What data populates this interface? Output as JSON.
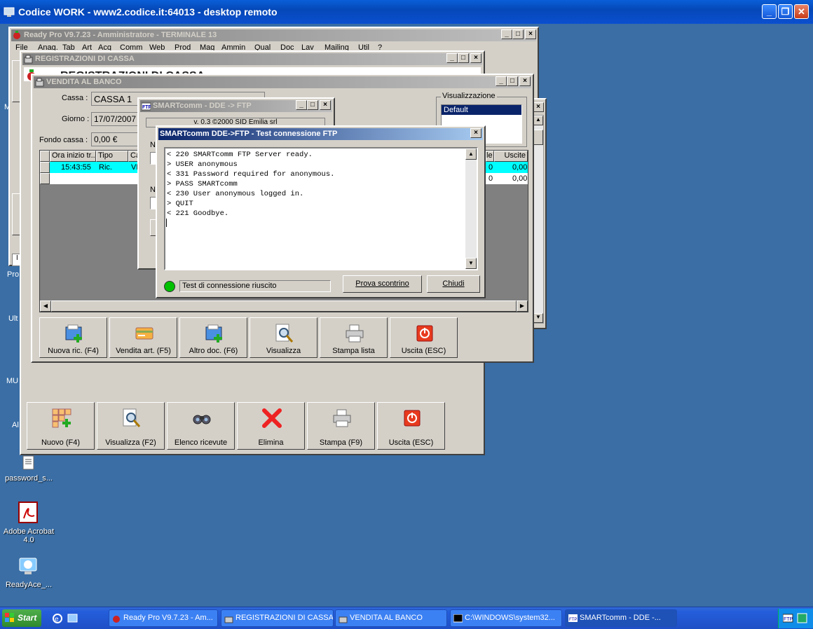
{
  "remote_desktop": {
    "title": "Codice WORK - www2.codice.it:64013 - desktop remoto"
  },
  "desktop_icons": [
    {
      "label": "password_s...",
      "icon": "text-file-icon"
    },
    {
      "label": "Adobe Acrobat 4.0",
      "icon": "acrobat-icon"
    },
    {
      "label": "ReadyAce_...",
      "icon": "readyace-icon"
    }
  ],
  "desktop_partial_labels": [
    "M",
    "Pro",
    "Ult",
    "MU",
    "Al"
  ],
  "readypro": {
    "title": "Ready Pro V9.7.23 - Amministratore - TERMINALE 13",
    "menu": [
      "File",
      "Anag.",
      "Tab",
      "Art",
      "Acq",
      "Comm",
      "Web",
      "Prod",
      "Mag",
      "Ammin",
      "Qual",
      "Doc",
      "Lav",
      "Mailing",
      "Util",
      "?"
    ]
  },
  "registrazioni": {
    "title": "REGISTRAZIONI DI CASSA",
    "header_text": "REGISTRAZIONI DI CASSA",
    "toolbar": [
      {
        "label": "Nuovo (F4)",
        "icon": "new-grid-icon"
      },
      {
        "label": "Visualizza (F2)",
        "icon": "magnifier-icon"
      },
      {
        "label": "Elenco ricevute",
        "icon": "binoculars-icon"
      },
      {
        "label": "Elimina",
        "icon": "delete-x-icon"
      },
      {
        "label": "Stampa (F9)",
        "icon": "printer-icon"
      },
      {
        "label": "Uscita (ESC)",
        "icon": "power-icon"
      }
    ]
  },
  "vendita": {
    "title": "VENDITA AL BANCO",
    "cassa_label": "Cassa :",
    "cassa_value": "CASSA 1",
    "giorno_label": "Giorno :",
    "giorno_value": "17/07/2007",
    "fondo_label": "Fondo cassa :",
    "fondo_value": "0,00 €",
    "visualizzazione_label": "Visualizzazione",
    "visualizzazione_items": [
      "Default"
    ],
    "grid_headers": [
      "Ora inizio tr...",
      "Tipo",
      "Ca"
    ],
    "grid_row": {
      "ora": "15:43:55",
      "tipo": "Ric.",
      "ca": "VE"
    },
    "grid_right_headers": [
      "le",
      "Uscite"
    ],
    "grid_right_row1": [
      "0",
      "0,00"
    ],
    "grid_right_row2": [
      "0",
      "0,00"
    ],
    "toolbar": [
      {
        "label": "Nuova ric. (F4)",
        "icon": "folder-add-icon"
      },
      {
        "label": "Vendita art. (F5)",
        "icon": "card-icon"
      },
      {
        "label": "Altro doc. (F6)",
        "icon": "folder-add-icon"
      },
      {
        "label": "Visualizza",
        "icon": "magnifier-icon"
      },
      {
        "label": "Stampa lista",
        "icon": "printer-icon"
      },
      {
        "label": "Uscita (ESC)",
        "icon": "power-icon"
      }
    ]
  },
  "smartcomm": {
    "title": "SMARTcomm - DDE -> FTP",
    "version": "v. 0.3 ©2000 SID Emilia srl",
    "field_letter": "N",
    "field_letter2": "N"
  },
  "test_dialog": {
    "title": "SMARTcomm DDE->FTP - Test connessione FTP",
    "log": [
      "< 220 SMARTcomm FTP Server ready.",
      "> USER anonymous",
      "< 331 Password required for anonymous.",
      "> PASS SMARTcomm",
      "< 230 User anonymous logged in.",
      "> QUIT",
      "< 221 Goodbye."
    ],
    "status": "Test di connessione riuscito",
    "status_color": "#00c000",
    "btn_prova": "Prova scontrino",
    "btn_chiudi": "Chiudi"
  },
  "taskbar": {
    "start": "Start",
    "items": [
      {
        "label": "Ready Pro V9.7.23 - Am...",
        "icon": "readypro-icon"
      },
      {
        "label": "REGISTRAZIONI DI CASSA",
        "icon": "register-icon"
      },
      {
        "label": "VENDITA AL BANCO",
        "icon": "register-icon"
      },
      {
        "label": "C:\\WINDOWS\\system32...",
        "icon": "cmd-icon"
      },
      {
        "label": "SMARTcomm - DDE -...",
        "icon": "ftp-icon"
      }
    ]
  }
}
